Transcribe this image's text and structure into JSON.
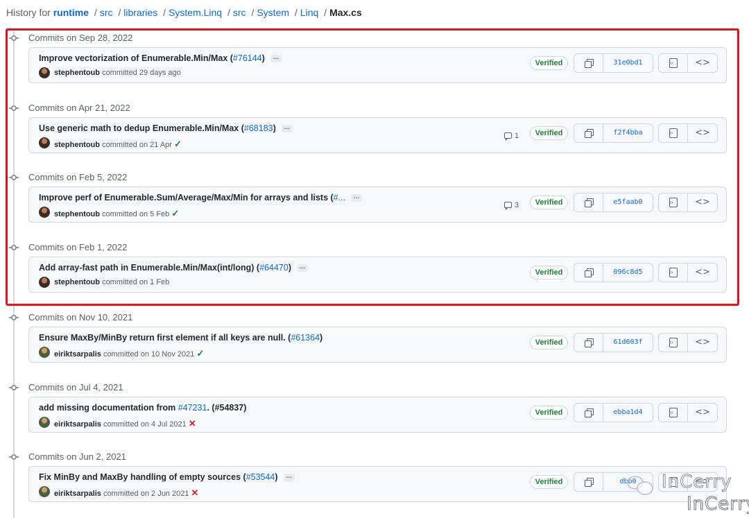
{
  "breadcrumb": {
    "prefix": "History for",
    "repo": "runtime",
    "parts": [
      "src",
      "libraries",
      "System.Linq",
      "src",
      "System",
      "Linq"
    ],
    "file": "Max.cs"
  },
  "groups": [
    {
      "header": "Commits on Sep 28, 2022",
      "commit": {
        "message": "Improve vectorization of Enumerable.Min/Max (",
        "pr": "#76144",
        "message_end": ")",
        "author": "stephentoub",
        "committed": "committed 29 days ago",
        "status": "",
        "comments": "",
        "verified": "Verified",
        "sha": "31e0bd1"
      }
    },
    {
      "header": "Commits on Apr 21, 2022",
      "commit": {
        "message": "Use generic math to dedup Enumerable.Min/Max (",
        "pr": "#68183",
        "message_end": ")",
        "author": "stephentoub",
        "committed": "committed on 21 Apr",
        "status": "✓",
        "comments": "1",
        "verified": "Verified",
        "sha": "f2f4bba"
      }
    },
    {
      "header": "Commits on Feb 5, 2022",
      "commit": {
        "message": "Improve perf of Enumerable.Sum/Average/Max/Min for arrays and lists (",
        "pr": "#...",
        "message_end": "",
        "author": "stephentoub",
        "committed": "committed on 5 Feb",
        "status": "✓",
        "comments": "3",
        "verified": "Verified",
        "sha": "e5faab0"
      }
    },
    {
      "header": "Commits on Feb 1, 2022",
      "commit": {
        "message": "Add array-fast path in Enumerable.Min/Max(int/long) (",
        "pr": "#64470",
        "message_end": ")",
        "author": "stephentoub",
        "committed": "committed on 1 Feb",
        "status": "",
        "comments": "",
        "verified": "Verified",
        "sha": "096c8d5"
      }
    },
    {
      "header": "Commits on Nov 10, 2021",
      "commit": {
        "message": "Ensure MaxBy/MinBy return first element if all keys are null. (",
        "pr": "#61364",
        "message_end": ")",
        "author": "eiriktsarpalis",
        "committed": "committed on 10 Nov 2021",
        "status": "✓",
        "comments": "",
        "verified": "Verified",
        "sha": "61d603f"
      }
    },
    {
      "header": "Commits on Jul 4, 2021",
      "commit": {
        "message": "add missing documentation from ",
        "pr": "#47231",
        "message_end": ". (#54837)",
        "author": "eiriktsarpalis",
        "committed": "committed on 4 Jul 2021",
        "status": "✕",
        "comments": "",
        "verified": "Verified",
        "sha": "ebba1d4"
      }
    },
    {
      "header": "Commits on Jun 2, 2021",
      "commit": {
        "message": "Fix MinBy and MaxBy handling of empty sources (",
        "pr": "#53544",
        "message_end": ")",
        "author": "eiriktsarpalis",
        "committed": "committed on 2 Jun 2021",
        "status": "✕",
        "comments": "",
        "verified": "Verified",
        "sha": "dbb0"
      }
    }
  ],
  "watermark": {
    "line1": "InCerry",
    "line2": "InCerry"
  },
  "colors": {
    "link": "#0969da",
    "success": "#1a7f37",
    "danger": "#cf222e",
    "highlight": "#e0141e"
  }
}
